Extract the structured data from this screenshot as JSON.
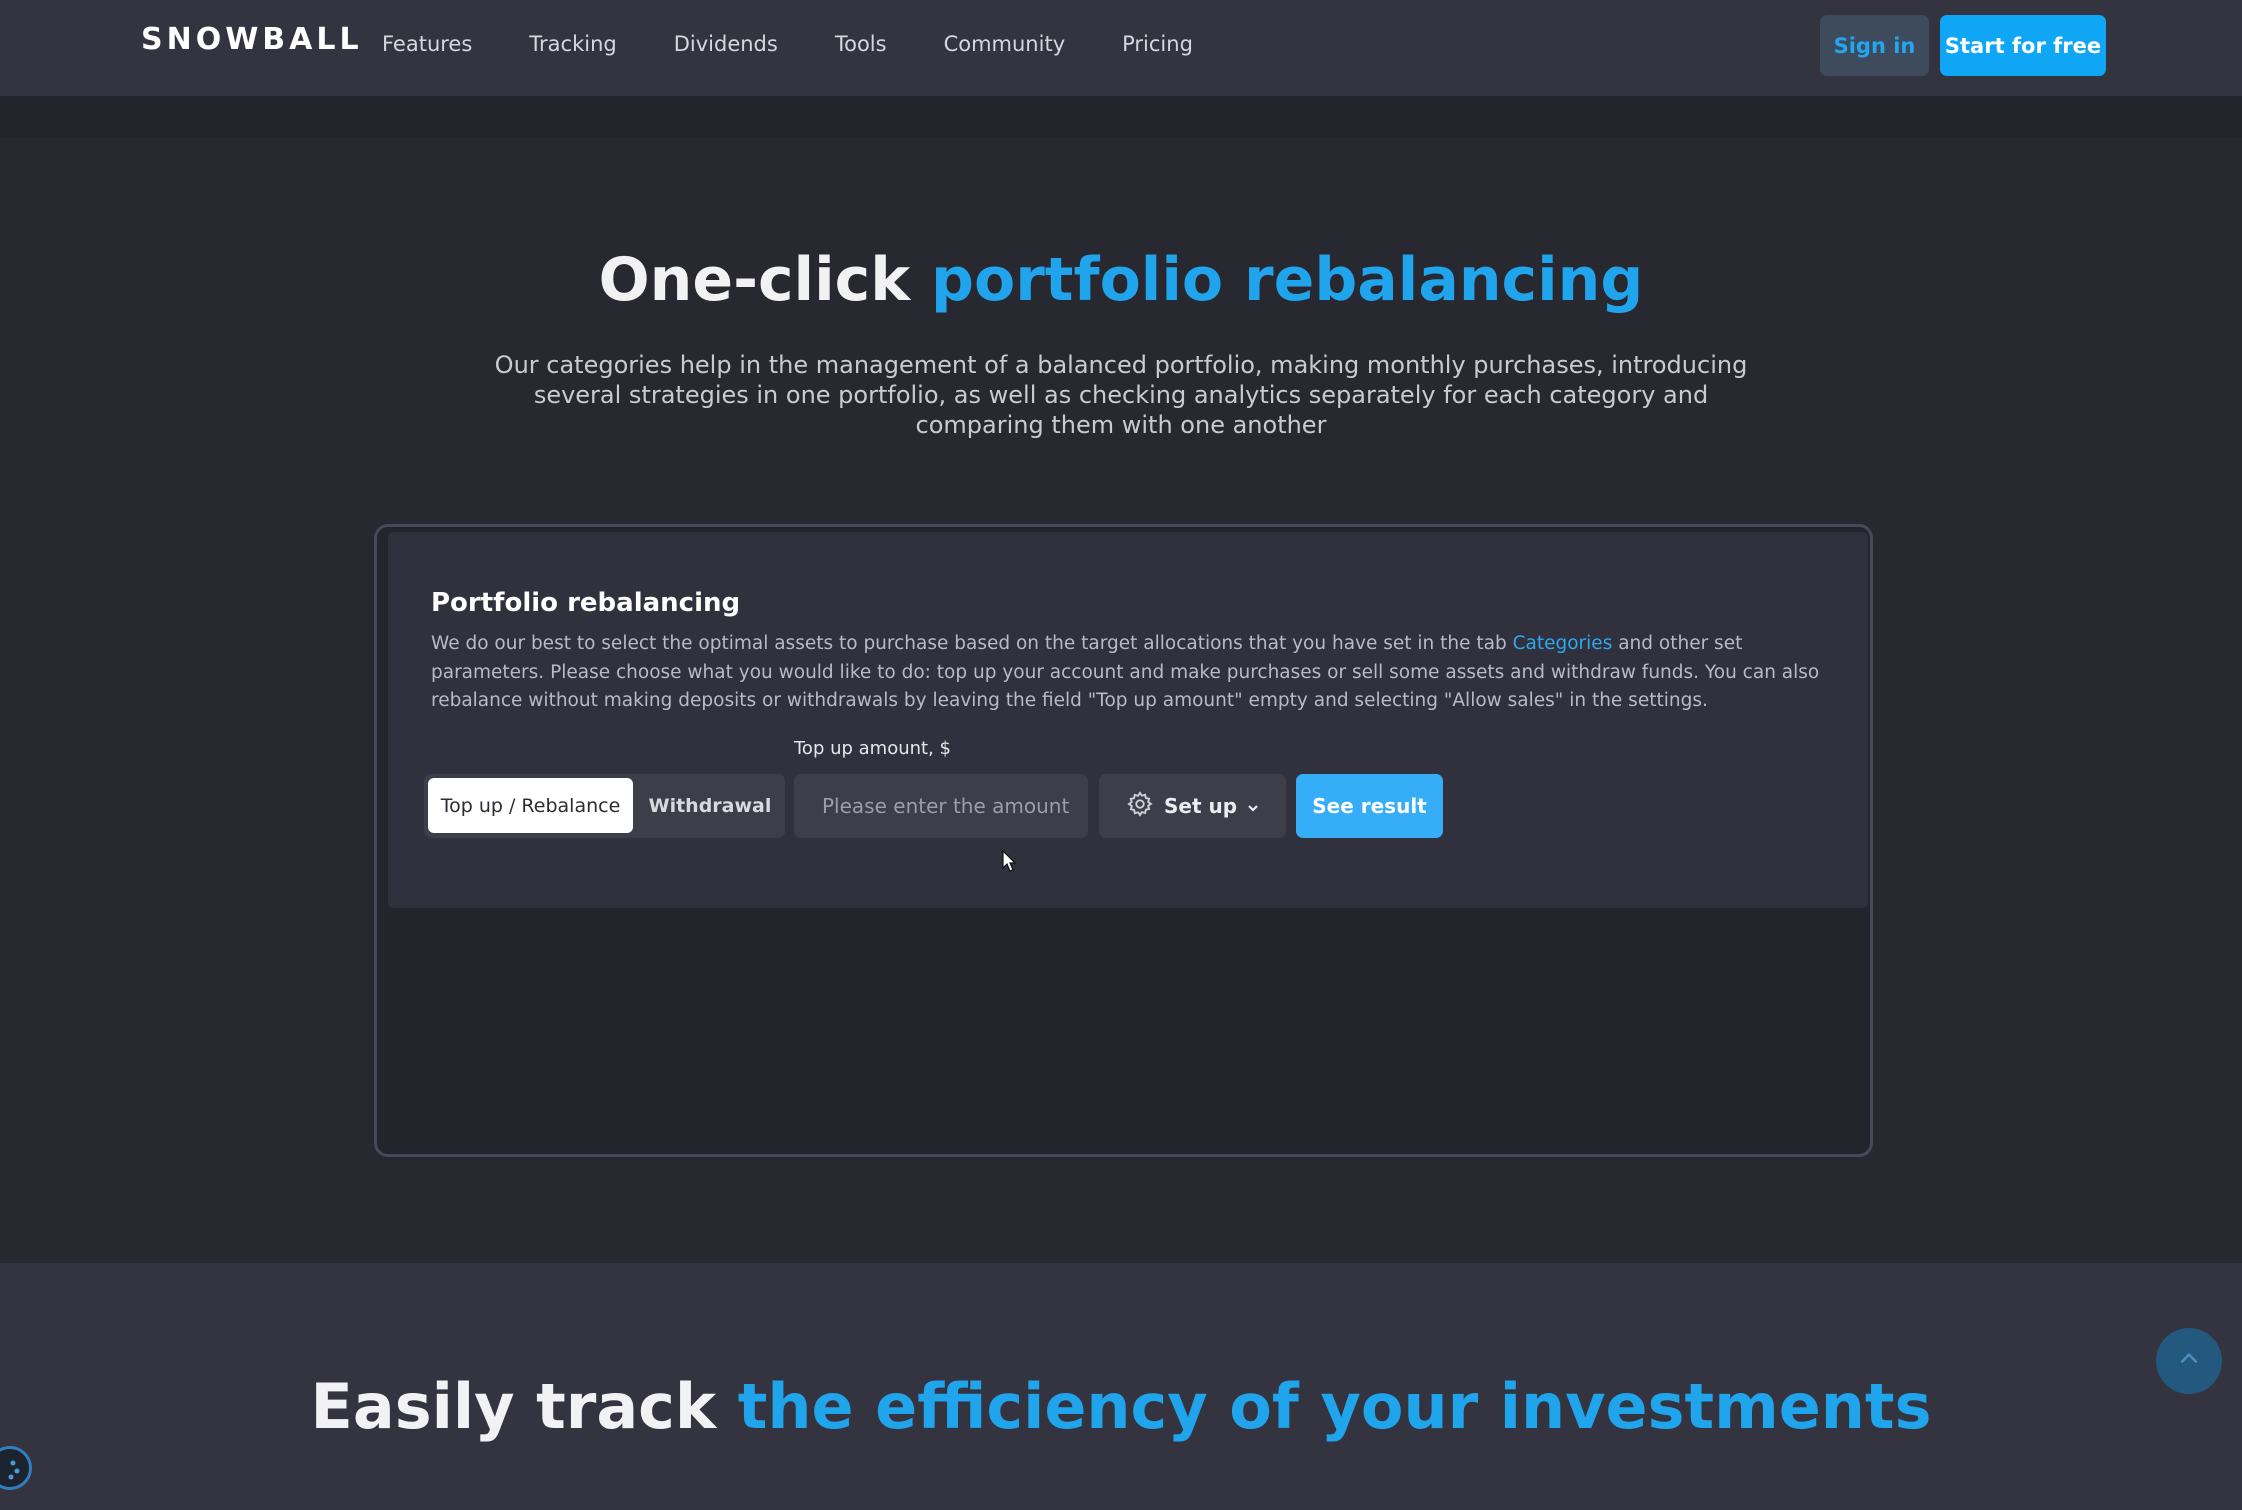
{
  "nav": {
    "logo": "SNOWBALL",
    "links": [
      "Features",
      "Tracking",
      "Dividends",
      "Tools",
      "Community",
      "Pricing"
    ],
    "sign_in": "Sign in",
    "start": "Start for free"
  },
  "hero": {
    "title_plain": "One-click ",
    "title_accent": "portfolio rebalancing",
    "description": "Our categories help in the management of a balanced portfolio, making monthly purchases, introducing several strategies in one portfolio, as well as checking analytics separately for each category and comparing them with one another"
  },
  "card": {
    "title": "Portfolio rebalancing",
    "desc_before": "We do our best to select the optimal assets to purchase based on the target allocations that you have set in the tab ",
    "desc_link": "Categories",
    "desc_after": " and other set parameters. Please choose what you would like to do: top up your account and make purchases or sell some assets and withdraw funds. You can also rebalance without making deposits or withdrawals by leaving the field \"Top up amount\" empty and selecting \"Allow sales\" in the settings.",
    "amount_label": "Top up amount, $",
    "mode_topup": "Top up / Rebalance",
    "mode_withdrawal": "Withdrawal",
    "amount_placeholder": "Please enter the amount",
    "amount_value": "",
    "setup": "Set up",
    "see_result": "See result"
  },
  "section2": {
    "title_plain": "Easily track ",
    "title_accent": "the efficiency of your investments"
  },
  "colors": {
    "accent": "#20a4ec",
    "button_primary": "#10a6f6",
    "background": "#282830"
  },
  "icons": [
    "gear-icon",
    "chevron-down-icon",
    "arrow-up-icon",
    "cookie-icon",
    "mouse-cursor-icon"
  ]
}
